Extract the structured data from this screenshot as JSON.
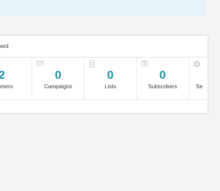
{
  "panel": {
    "title": "board"
  },
  "stats": [
    {
      "value": "2",
      "label": "tomers",
      "icon": "customers-icon"
    },
    {
      "value": "0",
      "label": "Campaigns",
      "icon": "campaign-icon"
    },
    {
      "value": "0",
      "label": "Lists",
      "icon": "list-icon"
    },
    {
      "value": "0",
      "label": "Subscribers",
      "icon": "subscribers-icon"
    },
    {
      "value": "",
      "label": "Se",
      "icon": "settings-icon"
    }
  ],
  "colors": {
    "accent": "#1a8fa8",
    "banner": "#e6f3f8",
    "background": "#f4f4f4"
  }
}
